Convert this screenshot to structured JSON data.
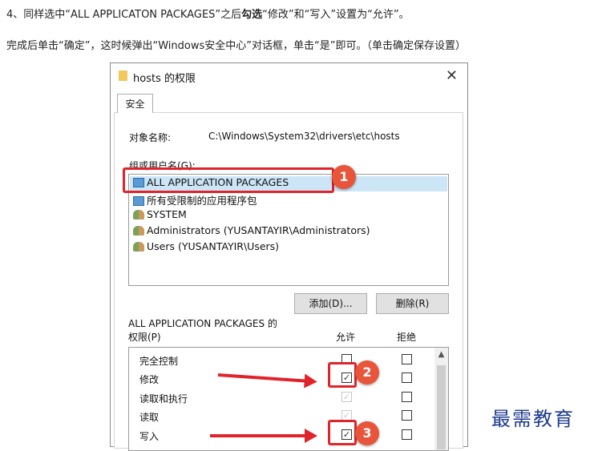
{
  "instructions": {
    "line1_a": "4、同样选中“ALL APPLICATON PACKAGES”之后",
    "line1_bold": "勾选",
    "line1_b": "“修改”和“写入”设置为“允许”。",
    "line2": "完成后单击“确定”，这时候弹出“Windows安全中心”对话框，单击“是”即可。（单击确定保存设置）"
  },
  "dialog": {
    "title": "hosts 的权限",
    "close_icon": "close-x-icon",
    "tab": "安全",
    "object_label": "对象名称:",
    "object_path": "C:\\Windows\\System32\\drivers\\etc\\hosts",
    "group_label": "组或用户名(G):",
    "users": [
      {
        "name": "ALL APPLICATION PACKAGES",
        "icon": "package-group-icon"
      },
      {
        "name": "所有受限制的应用程序包",
        "icon": "package-group-icon"
      },
      {
        "name": "SYSTEM",
        "icon": "user-group-icon"
      },
      {
        "name": "Administrators (YUSANTAYIR\\Administrators)",
        "icon": "user-group-icon"
      },
      {
        "name": "Users (YUSANTAYIR\\Users)",
        "icon": "user-group-icon"
      }
    ],
    "add_button": "添加(D)...",
    "remove_button": "删除(R)",
    "perm_for": "ALL APPLICATION PACKAGES 的",
    "perm_label": "权限(P)",
    "allow_header": "允许",
    "deny_header": "拒绝",
    "permissions": [
      {
        "name": "完全控制",
        "allow": false,
        "allow_disabled": false,
        "deny": false
      },
      {
        "name": "修改",
        "allow": true,
        "allow_disabled": false,
        "deny": false
      },
      {
        "name": "读取和执行",
        "allow": true,
        "allow_disabled": true,
        "deny": false
      },
      {
        "name": "读取",
        "allow": true,
        "allow_disabled": true,
        "deny": false
      },
      {
        "name": "写入",
        "allow": true,
        "allow_disabled": false,
        "deny": false
      }
    ]
  },
  "annotations": {
    "badge1": "1",
    "badge2": "2",
    "badge3": "3",
    "accent_color": "#e0242c"
  },
  "watermark": "最需教育"
}
